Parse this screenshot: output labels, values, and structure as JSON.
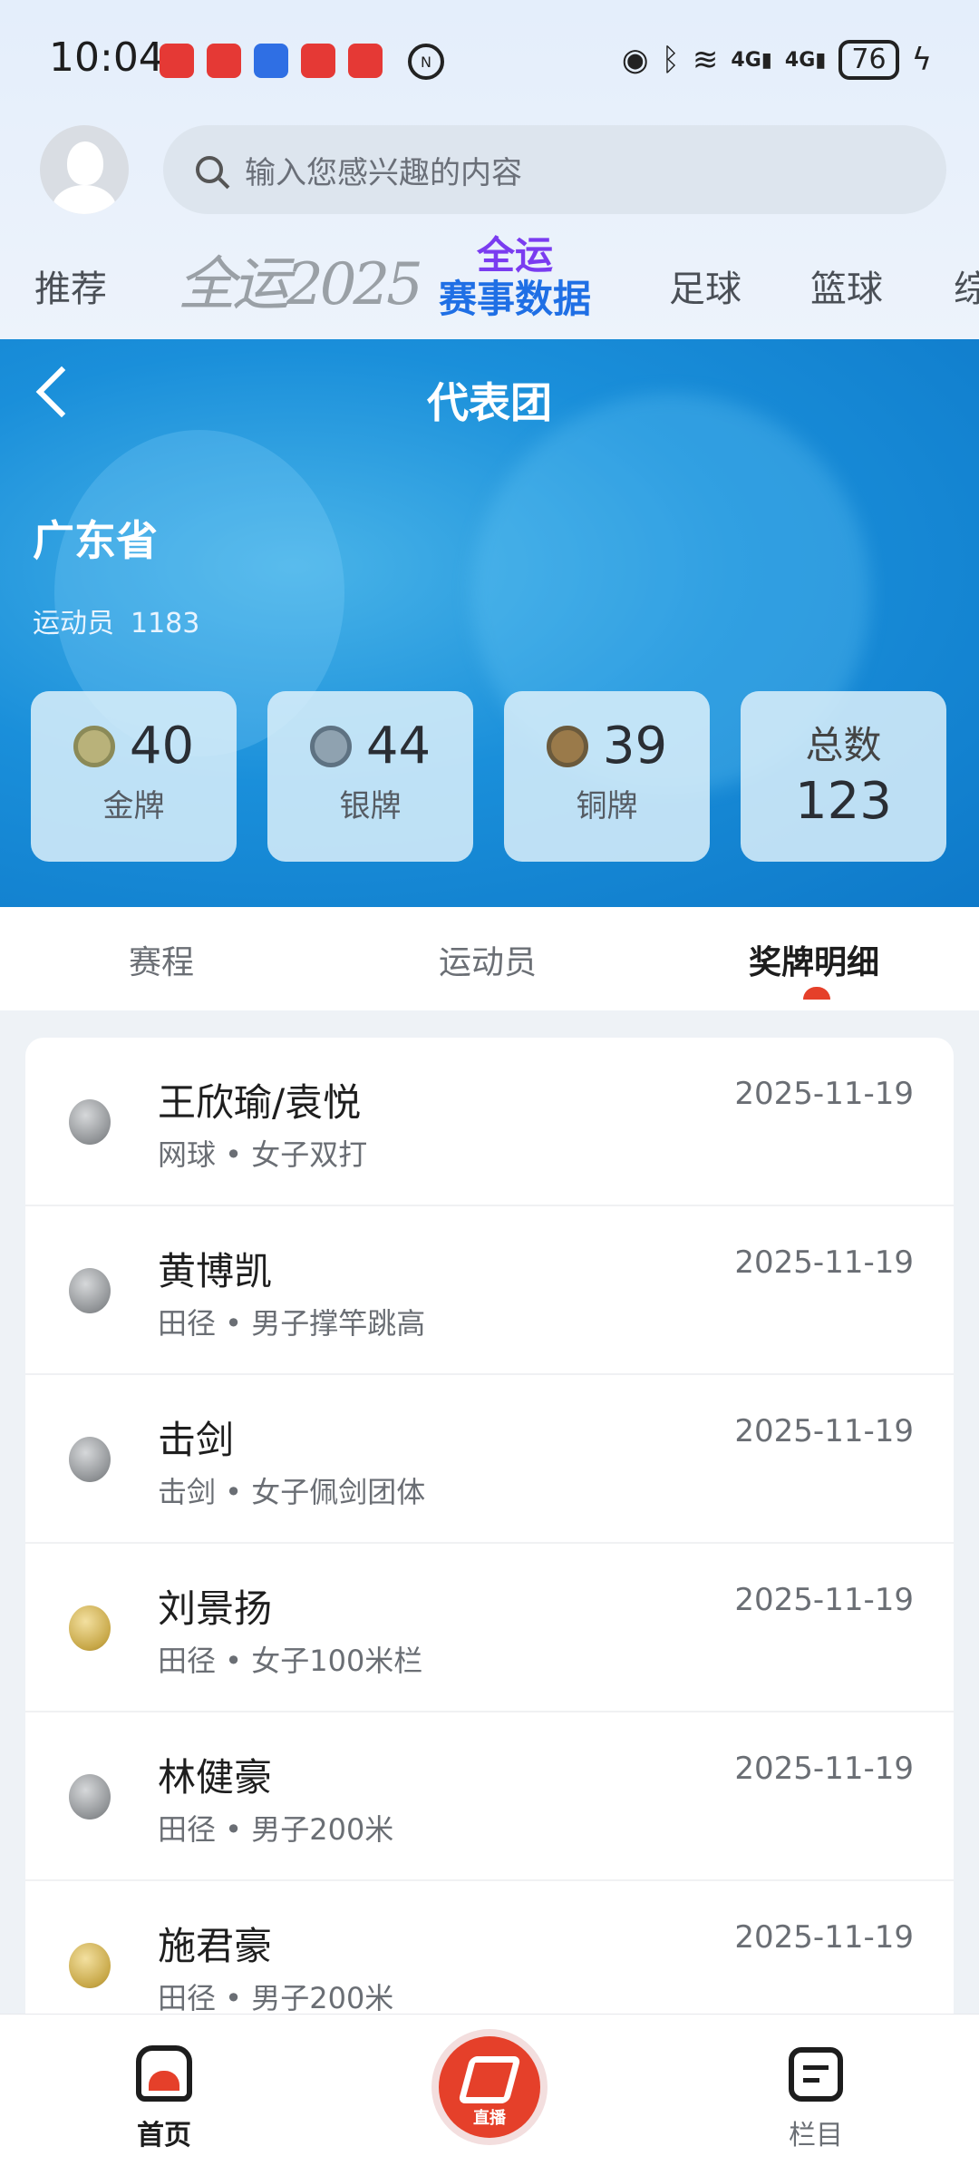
{
  "status_bar": {
    "time": "10:04",
    "network_1": "4G",
    "network_2": "4G",
    "battery": "76"
  },
  "search": {
    "placeholder": "输入您感兴趣的内容"
  },
  "nav_tabs": {
    "recommend": "推荐",
    "quanyun_2025": "全运2025",
    "stats_line1": "全运",
    "stats_line2": "赛事数据",
    "football": "足球",
    "basketball": "篮球",
    "partial": "综"
  },
  "header": {
    "title": "代表团"
  },
  "team": {
    "name": "广东省",
    "athletes_label": "运动员",
    "athletes_count": "1183"
  },
  "medals": {
    "gold": {
      "count": "40",
      "label": "金牌"
    },
    "silver": {
      "count": "44",
      "label": "银牌"
    },
    "bronze": {
      "count": "39",
      "label": "铜牌"
    },
    "total": {
      "label": "总数",
      "count": "123"
    }
  },
  "sub_tabs": {
    "schedule": "赛程",
    "athletes": "运动员",
    "medal_details": "奖牌明细"
  },
  "medal_list": [
    {
      "name": "王欣瑜/袁悦",
      "event": "网球 • 女子双打",
      "date": "2025-11-19",
      "medal": "silver"
    },
    {
      "name": "黄博凯",
      "event": "田径 • 男子撑竿跳高",
      "date": "2025-11-19",
      "medal": "silver"
    },
    {
      "name": "击剑",
      "event": "击剑 • 女子佩剑团体",
      "date": "2025-11-19",
      "medal": "silver"
    },
    {
      "name": "刘景扬",
      "event": "田径 • 女子100米栏",
      "date": "2025-11-19",
      "medal": "gold"
    },
    {
      "name": "林健豪",
      "event": "田径 • 男子200米",
      "date": "2025-11-19",
      "medal": "silver"
    },
    {
      "name": "施君豪",
      "event": "田径 • 男子200米",
      "date": "2025-11-19",
      "medal": "gold"
    }
  ],
  "bottom_bar": {
    "home": "首页",
    "live_tag": "直播",
    "columns": "栏目"
  },
  "colors": {
    "accent_red": "#e5402a",
    "hero_blue": "#1a8fda",
    "gold_medal": "#c7a747",
    "silver_medal": "#8f9295",
    "bronze_medal": "#9a7a4a"
  }
}
